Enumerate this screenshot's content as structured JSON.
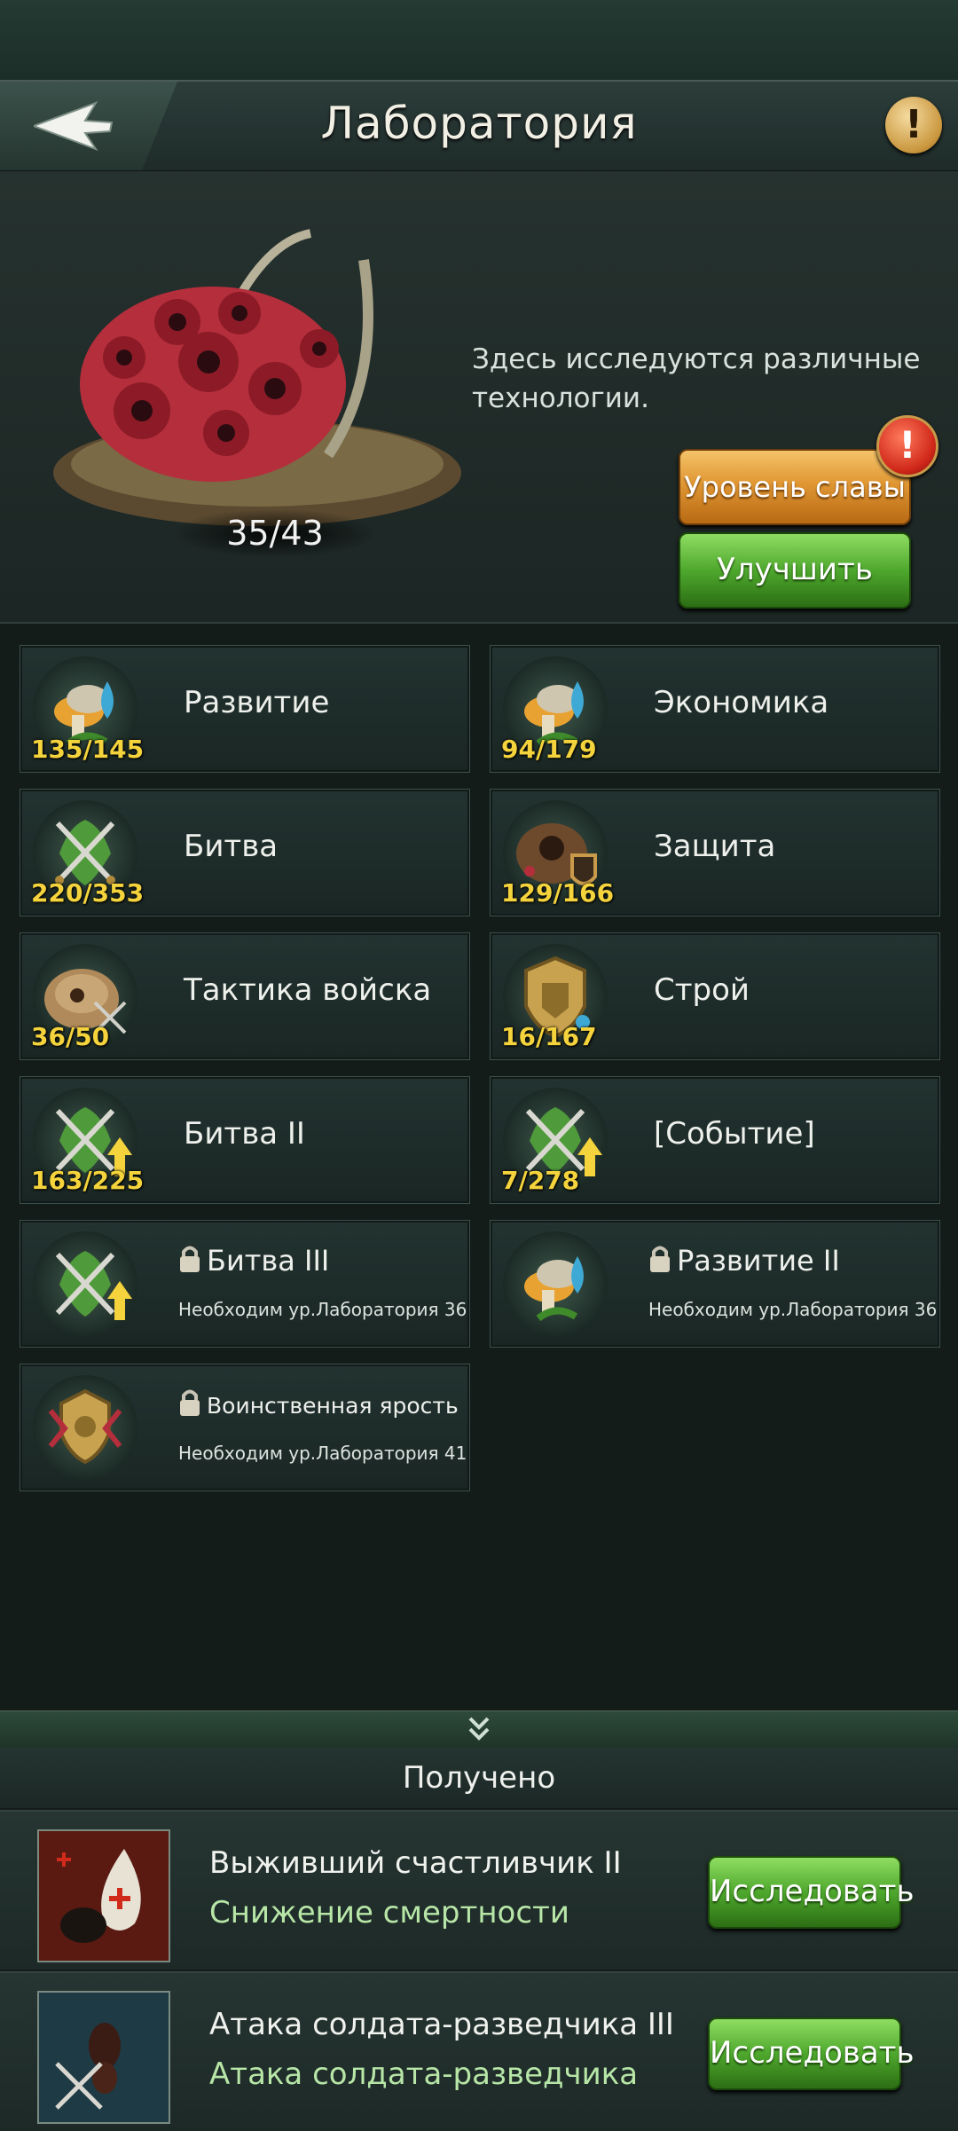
{
  "header": {
    "title": "Лаборатория"
  },
  "hero": {
    "progress": "35/43",
    "description": "Здесь исследуются различные технологии.",
    "glory_button": "Уровень славы",
    "upgrade_button": "Улучшить"
  },
  "categories": [
    {
      "label": "Развитие",
      "count": "135/145",
      "icon": "mushroom-water-icon"
    },
    {
      "label": "Экономика",
      "count": "94/179",
      "icon": "mushroom-water-icon"
    },
    {
      "label": "Битва",
      "count": "220/353",
      "icon": "crossed-swords-icon"
    },
    {
      "label": "Защита",
      "count": "129/166",
      "icon": "anthill-shield-icon"
    },
    {
      "label": "Тактика войска",
      "count": "36/50",
      "icon": "anthill-swords-icon"
    },
    {
      "label": "Строй",
      "count": "16/167",
      "icon": "golden-crest-icon"
    },
    {
      "label": "Битва II",
      "count": "163/225",
      "icon": "swords-arrow-up-icon"
    },
    {
      "label": "[Событие]",
      "count": "7/278",
      "icon": "swords-arrow-up-icon"
    },
    {
      "label": "Битва III",
      "requirement": "Необходим ур.Лаборатория 36",
      "icon": "swords-arrow-up-icon"
    },
    {
      "label": "Развитие II",
      "requirement": "Необходим ур.Лаборатория 36",
      "icon": "mushroom-water-icon"
    },
    {
      "label": "Воинственная ярость",
      "requirement": "Необходим ур.Лаборатория 41",
      "icon": "rage-crest-icon"
    }
  ],
  "received": {
    "title": "Получено",
    "items": [
      {
        "name": "Выживший счастливчик II",
        "subtitle": "Снижение смертности",
        "button": "Исследовать",
        "icon": "beetle-blood-drop-icon"
      },
      {
        "name": "Атака солдата-разведчика III",
        "subtitle": "Атака солдата-разведчика",
        "button": "Исследовать",
        "icon": "scout-ant-swords-icon"
      }
    ]
  },
  "colors": {
    "count_yellow": "#f4d33c",
    "button_green": "#4ea82d",
    "button_gold": "#e09733"
  }
}
